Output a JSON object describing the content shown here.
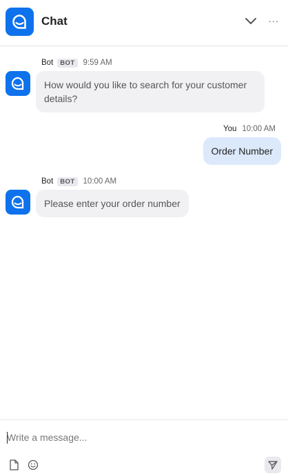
{
  "header": {
    "title": "Chat",
    "more_label": "···"
  },
  "messages": [
    {
      "sender": "Bot",
      "badge": "BOT",
      "time": "9:59 AM",
      "text": "How would you like to search for your customer details?"
    },
    {
      "sender": "You",
      "time": "10:00 AM",
      "text": "Order Number"
    },
    {
      "sender": "Bot",
      "badge": "BOT",
      "time": "10:00 AM",
      "text": "Please enter your order number"
    }
  ],
  "composer": {
    "placeholder": "Write a message..."
  },
  "colors": {
    "brand": "#0e72ed",
    "bot_bubble": "#f1f1f4",
    "user_bubble": "#dce9fb"
  }
}
